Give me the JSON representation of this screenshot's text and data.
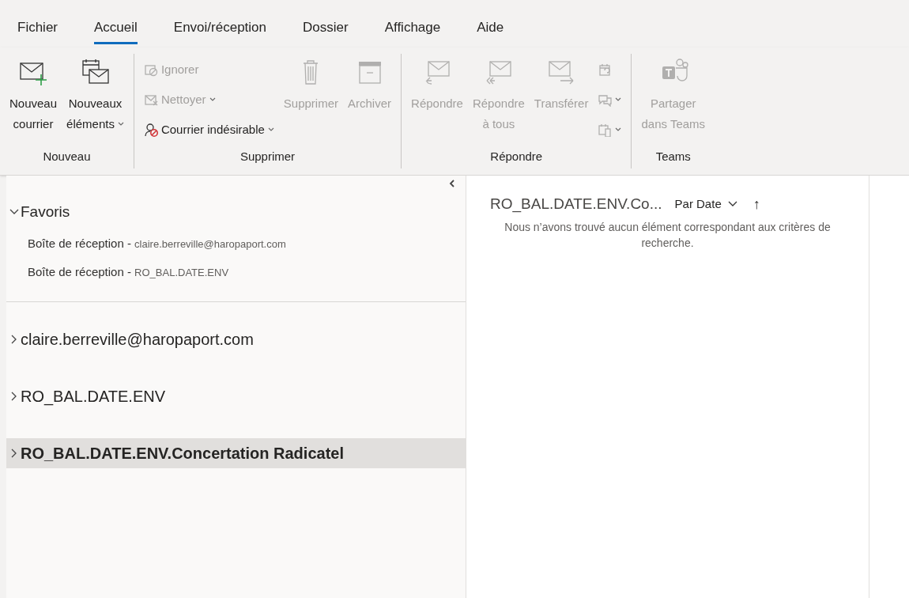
{
  "menu_tabs": [
    {
      "label": "Fichier",
      "selected": false
    },
    {
      "label": "Accueil",
      "selected": true
    },
    {
      "label": "Envoi/réception",
      "selected": false
    },
    {
      "label": "Dossier",
      "selected": false
    },
    {
      "label": "Affichage",
      "selected": false
    },
    {
      "label": "Aide",
      "selected": false
    }
  ],
  "ribbon": [
    {
      "group": "Nouveau",
      "items": [
        {
          "kind": "large",
          "lines": [
            "Nouveau",
            "courrier"
          ],
          "dropdown": false,
          "disabled": false
        },
        {
          "kind": "large",
          "lines": [
            "Nouveaux",
            "éléments"
          ],
          "dropdown": true,
          "disabled": false
        }
      ]
    },
    {
      "group": "Supprimer",
      "items": [
        {
          "kind": "stack",
          "entries": [
            {
              "label": "Ignorer",
              "dropdown": false,
              "disabled": true
            },
            {
              "label": "Nettoyer",
              "dropdown": true,
              "disabled": true
            },
            {
              "label": "Courrier indésirable",
              "dropdown": true,
              "disabled": false
            }
          ]
        },
        {
          "kind": "large",
          "lines": [
            "Supprimer"
          ],
          "dropdown": false,
          "disabled": true
        },
        {
          "kind": "large",
          "lines": [
            "Archiver"
          ],
          "dropdown": false,
          "disabled": true
        }
      ]
    },
    {
      "group": "Répondre",
      "items": [
        {
          "kind": "large",
          "lines": [
            "Répondre"
          ],
          "dropdown": false,
          "disabled": true
        },
        {
          "kind": "large",
          "lines": [
            "Répondre",
            "à tous"
          ],
          "dropdown": false,
          "disabled": true
        },
        {
          "kind": "large",
          "lines": [
            "Transférer"
          ],
          "dropdown": false,
          "disabled": true
        },
        {
          "kind": "stack",
          "entries": [
            {
              "dropdown": false,
              "disabled": true
            },
            {
              "dropdown": true,
              "disabled": true
            },
            {
              "dropdown": true,
              "disabled": true
            }
          ]
        }
      ]
    },
    {
      "group": "Teams",
      "items": [
        {
          "kind": "large",
          "lines": [
            "Partager",
            "dans Teams"
          ],
          "dropdown": false,
          "disabled": true
        }
      ]
    }
  ],
  "favorites": {
    "title": "Favoris",
    "expanded": true,
    "items": [
      {
        "folder": "Boîte de réception - ",
        "account": "claire.berreville@haropaport.com"
      },
      {
        "folder": "Boîte de réception - ",
        "account": "RO_BAL.DATE.ENV"
      }
    ]
  },
  "accounts": [
    {
      "name": "claire.berreville@haropaport.com",
      "expanded": false,
      "selected": false
    },
    {
      "name": "RO_BAL.DATE.ENV",
      "expanded": false,
      "selected": false
    },
    {
      "name": "RO_BAL.DATE.ENV.Concertation Radicatel",
      "expanded": false,
      "selected": true
    }
  ],
  "message_list": {
    "folder": "RO_BAL.DATE.ENV.Co...",
    "sort": "Par Date",
    "sort_arrow": "↑",
    "empty_message": "Nous n’avons trouvé aucun élément correspondant aux critères de recherche."
  }
}
